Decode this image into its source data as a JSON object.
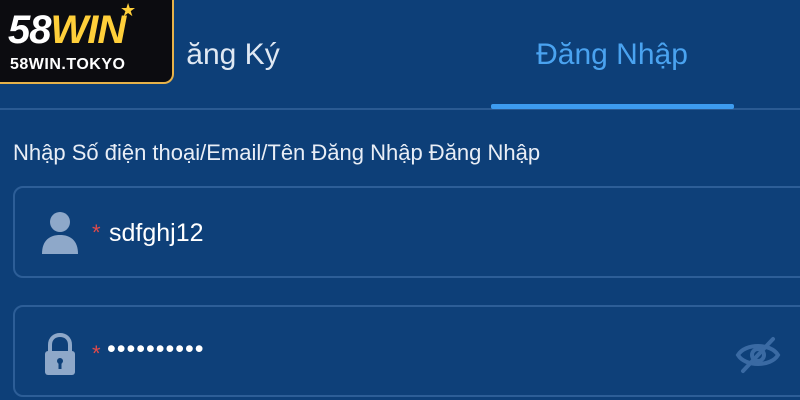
{
  "brand": {
    "name_part1": "58",
    "name_part2": "WIN",
    "star": "★",
    "domain": "58WIN.TOKYO"
  },
  "tabs": [
    {
      "label": "Đăng Ký",
      "visible_text": "ăng Ký",
      "active": false
    },
    {
      "label": "Đăng Nhập",
      "visible_text": "Đăng Nhập",
      "active": true
    }
  ],
  "form": {
    "label": "Nhập Số điện thoại/Email/Tên Đăng Nhập Đăng Nhập",
    "username": {
      "required_mark": "*",
      "value": "sdfghj12",
      "icon": "user-icon"
    },
    "password": {
      "required_mark": "*",
      "value": "••••••••••",
      "icon": "lock-icon",
      "toggle_icon": "eye-slash-icon"
    }
  },
  "colors": {
    "background": "#0d3f78",
    "active_tab": "#4aa3f0",
    "required": "#e04a4a",
    "brand_gold": "#ffcf3a"
  }
}
